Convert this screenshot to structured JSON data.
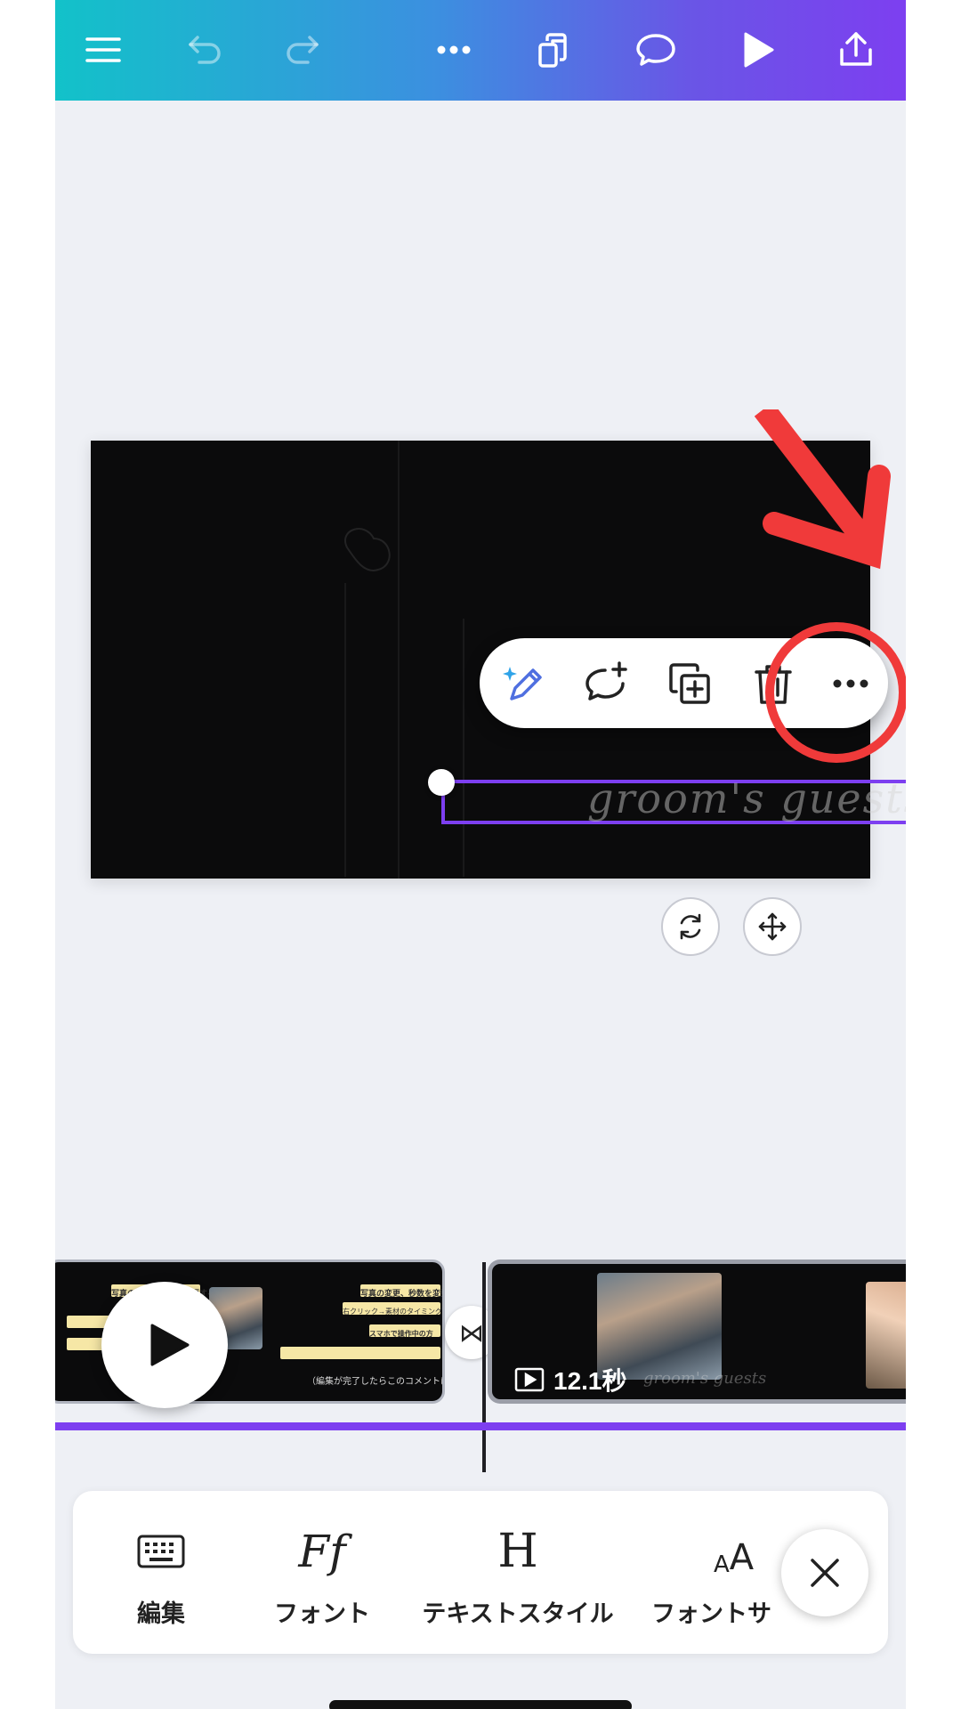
{
  "topbar": {
    "icons": [
      "menu-icon",
      "undo-icon",
      "redo-icon",
      "more-icon",
      "copy-pages-icon",
      "comment-icon",
      "play-icon",
      "share-icon"
    ],
    "gradient": [
      "#12c2c9",
      "#7d3ff0"
    ]
  },
  "canvas": {
    "selected_text": "groom's guests",
    "selection_color": "#7d3ff0"
  },
  "context_menu": {
    "icons": [
      "magic-edit-icon",
      "add-comment-icon",
      "duplicate-icon",
      "delete-icon",
      "more-icon"
    ]
  },
  "annotation": {
    "color": "#f03a3a"
  },
  "timeline": {
    "clip_duration": "12.1秒",
    "left_clip_notes": [
      "写真の変更、秒数を変更する場合",
      "右クリック→素材のタイミング",
      "スマホで操作中の方",
      "（編集が完了したらこのコメントは削除"
    ],
    "watermark": "groom's guests"
  },
  "bottom_toolbar": {
    "items": [
      {
        "icon": "keyboard-icon",
        "label": "編集"
      },
      {
        "icon": "font-icon",
        "label": "フォント"
      },
      {
        "icon": "text-style-icon",
        "label": "テキストスタイル"
      },
      {
        "icon": "font-size-icon",
        "label": "フォントサ"
      }
    ],
    "font_icon_glyph": "Ff",
    "text_style_glyph": "H",
    "font_size_glyph_small": "A",
    "font_size_glyph_large": "A"
  }
}
